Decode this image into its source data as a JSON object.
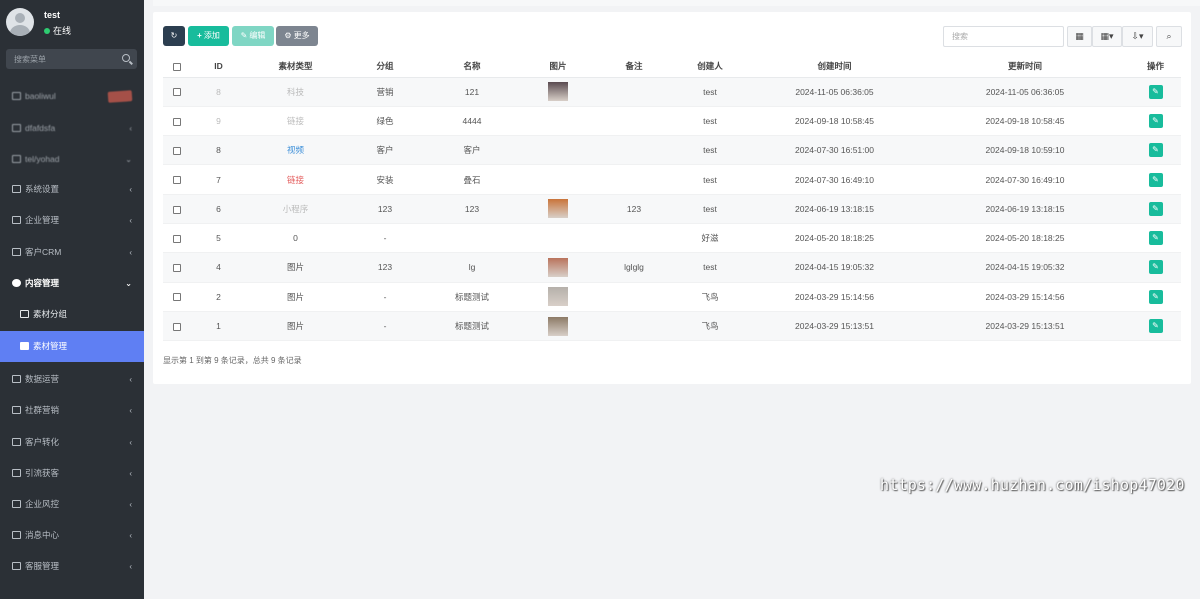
{
  "user": {
    "name": "test",
    "status": "在线"
  },
  "sidebar": {
    "search_placeholder": "搜索菜单",
    "items": [
      {
        "label": "baoliwul",
        "icon": "rocket-icon",
        "arrow": ""
      },
      {
        "label": "dfafdsfa",
        "icon": "list-icon",
        "arrow": "‹"
      },
      {
        "label": "tel/yohad",
        "icon": "glasses-icon",
        "arrow": "⌄"
      },
      {
        "label": "系统设置",
        "icon": "settings-icon",
        "arrow": "‹"
      },
      {
        "label": "企业管理",
        "icon": "bank-icon",
        "arrow": "‹"
      },
      {
        "label": "客户CRM",
        "icon": "eye-icon",
        "arrow": "‹"
      },
      {
        "label": "内容管理",
        "icon": "cube-icon",
        "arrow": "⌄"
      },
      {
        "label": "素材分组",
        "icon": "group-icon",
        "arrow": ""
      },
      {
        "label": "素材管理",
        "icon": "book-icon",
        "arrow": ""
      },
      {
        "label": "数据运营",
        "icon": "chart-icon",
        "arrow": "‹"
      },
      {
        "label": "社群营销",
        "icon": "share-icon",
        "arrow": "‹"
      },
      {
        "label": "客户转化",
        "icon": "retweet-icon",
        "arrow": "‹"
      },
      {
        "label": "引流获客",
        "icon": "download-icon",
        "arrow": "‹"
      },
      {
        "label": "企业风控",
        "icon": "circle-icon",
        "arrow": "‹"
      },
      {
        "label": "消息中心",
        "icon": "message-icon",
        "arrow": "‹"
      },
      {
        "label": "客服管理",
        "icon": "inbox-icon",
        "arrow": "‹"
      }
    ]
  },
  "toolbar": {
    "refresh_label": "↻",
    "add_label": "添加",
    "edit_label": "编辑",
    "more_label": "更多",
    "search_placeholder": "搜索",
    "view_toggle": "▦",
    "columns_label": "▦▾",
    "export_label": "⇩▾",
    "search_btn": "⌕"
  },
  "table": {
    "headers": [
      "ID",
      "素材类型",
      "分组",
      "名称",
      "图片",
      "备注",
      "创建人",
      "创建时间",
      "更新时间",
      "操作"
    ],
    "rows": [
      {
        "id": "8",
        "type": "科技",
        "group": "营销",
        "name": "121",
        "image": "#5a4b50",
        "note": "",
        "creator": "test",
        "created": "2024-11-05 06:36:05",
        "updated": "2024-11-05 06:36:05"
      },
      {
        "id": "9",
        "type": "链接",
        "group": "绿色",
        "name": "4444",
        "image": "",
        "note": "",
        "creator": "test",
        "created": "2024-09-18 10:58:45",
        "updated": "2024-09-18 10:58:45"
      },
      {
        "id": "8",
        "type": "视频",
        "group": "客户",
        "name": "客户",
        "image": "",
        "note": "",
        "creator": "test",
        "created": "2024-07-30 16:51:00",
        "updated": "2024-09-18 10:59:10"
      },
      {
        "id": "7",
        "type": "链接",
        "group": "安装",
        "name": "叠石",
        "image": "",
        "note": "",
        "creator": "test",
        "created": "2024-07-30 16:49:10",
        "updated": "2024-07-30 16:49:10"
      },
      {
        "id": "6",
        "type": "小程序",
        "group": "123",
        "name": "123",
        "image": "#c9743a",
        "note": "123",
        "creator": "test",
        "created": "2024-06-19 13:18:15",
        "updated": "2024-06-19 13:18:15"
      },
      {
        "id": "5",
        "type": "0",
        "group": "-",
        "name": "",
        "image": "",
        "note": "",
        "creator": "好滋",
        "created": "2024-05-20 18:18:25",
        "updated": "2024-05-20 18:18:25"
      },
      {
        "id": "4",
        "type": "图片",
        "group": "123",
        "name": "lg",
        "image": "#b9735c",
        "note": "lglglg",
        "creator": "test",
        "created": "2024-04-15 19:05:32",
        "updated": "2024-04-15 19:05:32"
      },
      {
        "id": "2",
        "type": "图片",
        "group": "-",
        "name": "标题测试",
        "image": "#b5b0aa",
        "note": "",
        "creator": "飞鸟",
        "created": "2024-03-29 15:14:56",
        "updated": "2024-03-29 15:14:56"
      },
      {
        "id": "1",
        "type": "图片",
        "group": "-",
        "name": "标题测试",
        "image": "#8c7a66",
        "note": "",
        "creator": "飞鸟",
        "created": "2024-03-29 15:13:51",
        "updated": "2024-03-29 15:13:51"
      }
    ]
  },
  "footer": "显示第 1 到第 9 条记录，总共 9 条记录",
  "watermark": "https://www.huzhan.com/ishop47020",
  "colors": {
    "sidebar_bg": "#2b3036",
    "active_item": "#5f7ff3",
    "success": "#18bc9c",
    "dark_btn": "#2c3e50"
  }
}
